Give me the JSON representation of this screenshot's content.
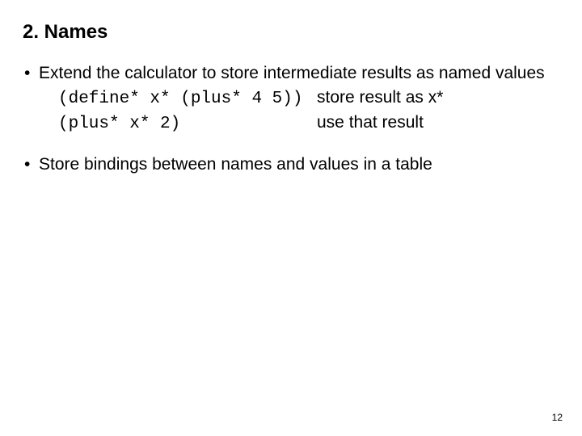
{
  "title": "2. Names",
  "bullet1_lead": "Extend the calculator to store intermediate results as named values",
  "example": {
    "row1_code": "(define* x* (plus* 4 5))",
    "row1_comment": "store result as x*",
    "row2_code": "(plus* x* 2)",
    "row2_comment": "use that result"
  },
  "bullet2": "Store bindings between names and values in a table",
  "page_number": "12"
}
